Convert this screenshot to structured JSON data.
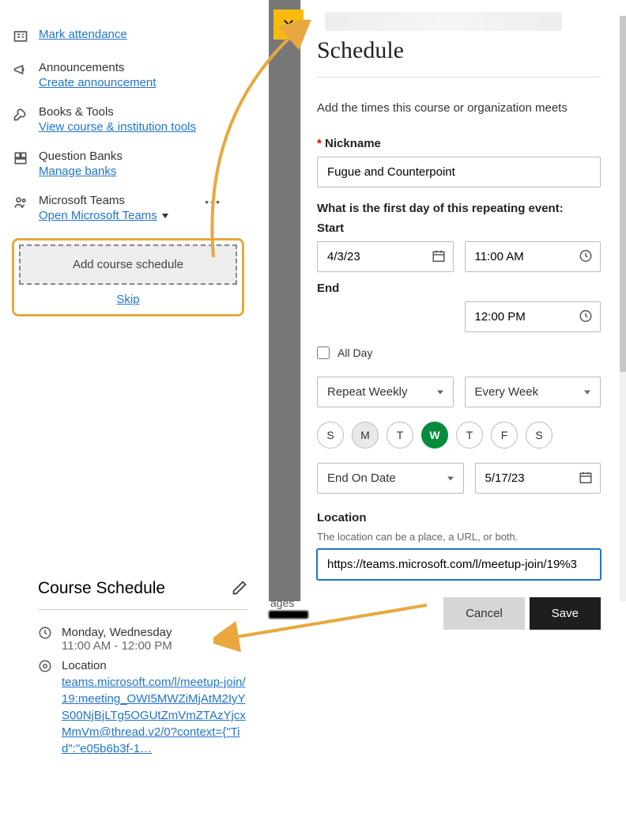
{
  "sidebar": {
    "attendance": {
      "link": "Mark attendance"
    },
    "announce": {
      "heading": "Announcements",
      "link": "Create announcement"
    },
    "books": {
      "heading": "Books & Tools",
      "link": "View course & institution tools"
    },
    "qbanks": {
      "heading": "Question Banks",
      "link": "Manage banks"
    },
    "teams": {
      "heading": "Microsoft Teams",
      "link": "Open Microsoft Teams"
    },
    "add_schedule_btn": "Add course schedule",
    "skip": "Skip"
  },
  "schedule_card": {
    "title": "Course Schedule",
    "days": "Monday, Wednesday",
    "time": "11:00 AM - 12:00 PM",
    "loc_label": "Location",
    "loc_url": "teams.microsoft.com/l/meetup-join/19:meeting_OWI5MWZiMjAtM2IyYS00NjBjLTg5OGUtZmVmZTAzYjcxMmVm@thread.v2/0?context={\"Tid\":\"e05b6b3f-1…"
  },
  "panel": {
    "title": "Schedule",
    "desc": "Add the times this course or organization meets",
    "nickname_label": "Nickname",
    "nickname_value": "Fugue and Counterpoint",
    "first_day_label": "What is the first day of this repeating event:",
    "start_label": "Start",
    "end_label": "End",
    "start_date": "4/3/23",
    "start_time": "11:00 AM",
    "end_time": "12:00 PM",
    "all_day": "All Day",
    "repeat": "Repeat Weekly",
    "every": "Every Week",
    "days": [
      "S",
      "M",
      "T",
      "W",
      "T",
      "F",
      "S"
    ],
    "end_on": "End On Date",
    "end_date": "5/17/23",
    "location_label": "Location",
    "location_hint": "The location can be a place, a URL, or both.",
    "location_value": "https://teams.microsoft.com/l/meetup-join/19%3",
    "cancel": "Cancel",
    "save": "Save"
  },
  "bg_text": "ages"
}
